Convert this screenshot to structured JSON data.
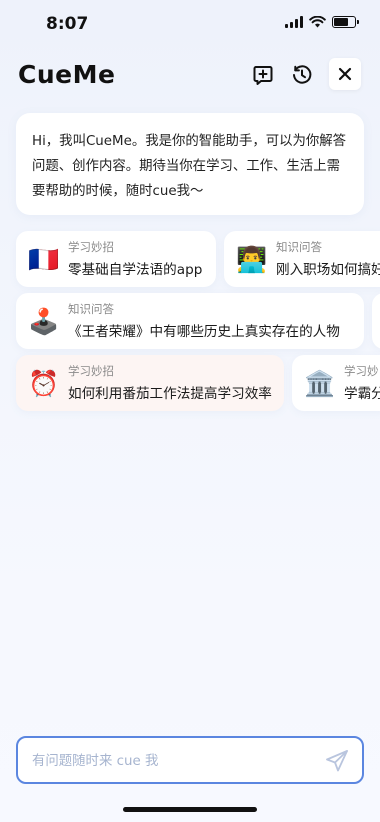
{
  "status": {
    "time": "8:07"
  },
  "app": {
    "logo": "CueMe"
  },
  "header": {
    "new_chat_icon": "plus-square-icon",
    "history_icon": "history-clock-icon",
    "close_icon": "close-icon"
  },
  "greeting": {
    "text": "Hi，我叫CueMe。我是你的智能助手，可以为你解答问题、创作内容。期待当你在学习、工作、生活上需要帮助的时候，随时cue我～"
  },
  "suggestions": {
    "row1": [
      {
        "emoji": "🇫🇷",
        "category": "学习妙招",
        "title": "零基础自学法语的app"
      },
      {
        "emoji": "👨‍💻",
        "category": "知识问答",
        "title": "刚入职场如何搞好"
      }
    ],
    "row2": [
      {
        "emoji": "🕹️",
        "category": "知识问答",
        "title": "《王者荣耀》中有哪些历史上真实存在的人物"
      }
    ],
    "row3": [
      {
        "emoji": "⏰",
        "category": "学习妙招",
        "title": "如何利用番茄工作法提高学习效率"
      },
      {
        "emoji": "🏛️",
        "category": "学习妙",
        "title": "学霸分"
      }
    ]
  },
  "input": {
    "placeholder": "有问题随时来 cue 我",
    "send_icon": "send-icon"
  },
  "colors": {
    "accent": "#5b86e0",
    "placeholder": "#a6b4cf",
    "alarm_chip_bg": "#fdf5f3"
  }
}
